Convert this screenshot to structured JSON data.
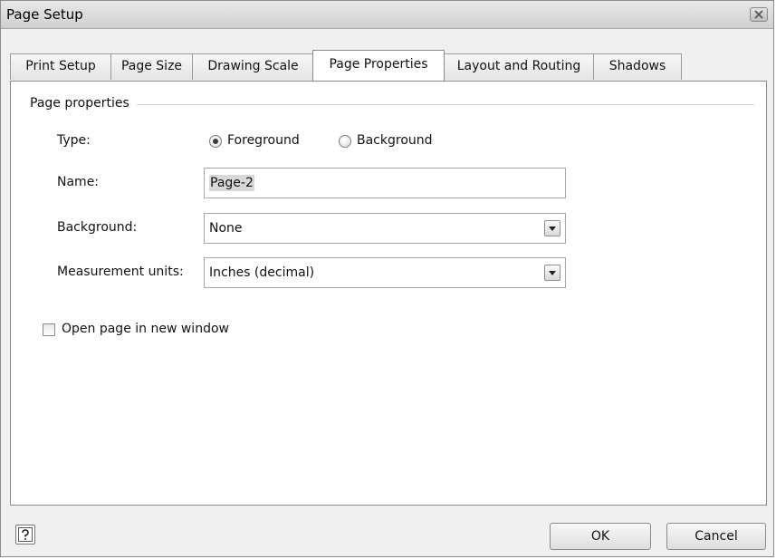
{
  "window": {
    "title": "Page Setup"
  },
  "tabs": [
    {
      "label": "Print Setup",
      "active": false
    },
    {
      "label": "Page Size",
      "active": false
    },
    {
      "label": "Drawing Scale",
      "active": false
    },
    {
      "label": "Page Properties",
      "active": true
    },
    {
      "label": "Layout and Routing",
      "active": false
    },
    {
      "label": "Shadows",
      "active": false
    }
  ],
  "page_properties": {
    "group_label": "Page properties",
    "type": {
      "label": "Type:",
      "options": [
        {
          "label": "Foreground",
          "selected": true
        },
        {
          "label": "Background",
          "selected": false
        }
      ]
    },
    "name": {
      "label": "Name:",
      "value": "Page-2"
    },
    "background": {
      "label": "Background:",
      "value": "None"
    },
    "measurement_units": {
      "label": "Measurement units:",
      "value": "Inches (decimal)"
    },
    "open_in_new_window": {
      "label": "Open page in new window",
      "checked": false
    }
  },
  "footer": {
    "help_icon": "question-mark-icon",
    "ok_label": "OK",
    "cancel_label": "Cancel"
  }
}
